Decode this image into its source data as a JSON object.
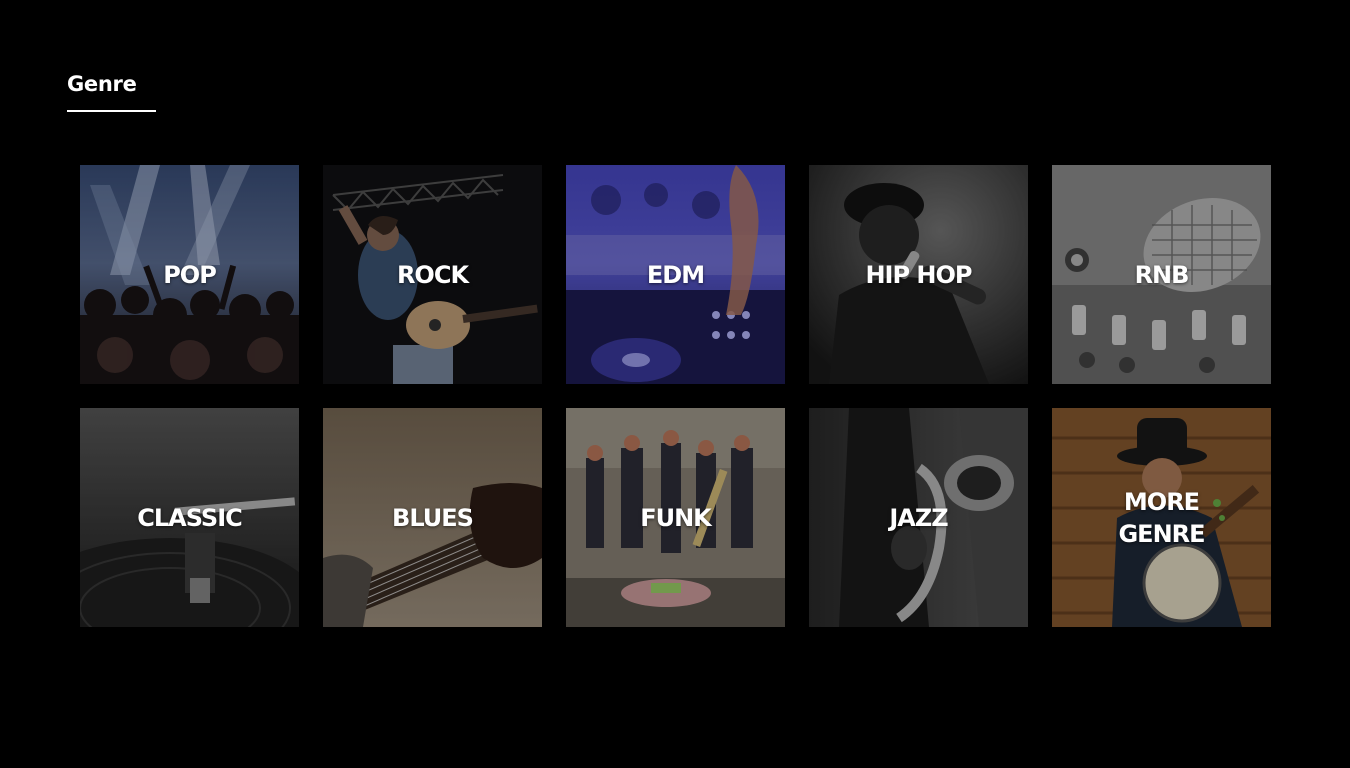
{
  "header": {
    "title": "Genre"
  },
  "genres": [
    {
      "label": "POP"
    },
    {
      "label": "ROCK"
    },
    {
      "label": "EDM"
    },
    {
      "label": "HIP HOP"
    },
    {
      "label": "RNB"
    },
    {
      "label": "CLASSIC"
    },
    {
      "label": "BLUES"
    },
    {
      "label": "FUNK"
    },
    {
      "label": "JAZZ"
    },
    {
      "label": "MORE GENRE"
    }
  ],
  "colors": {
    "background": "#000000",
    "text": "#ffffff",
    "underline": "#ffffff"
  }
}
